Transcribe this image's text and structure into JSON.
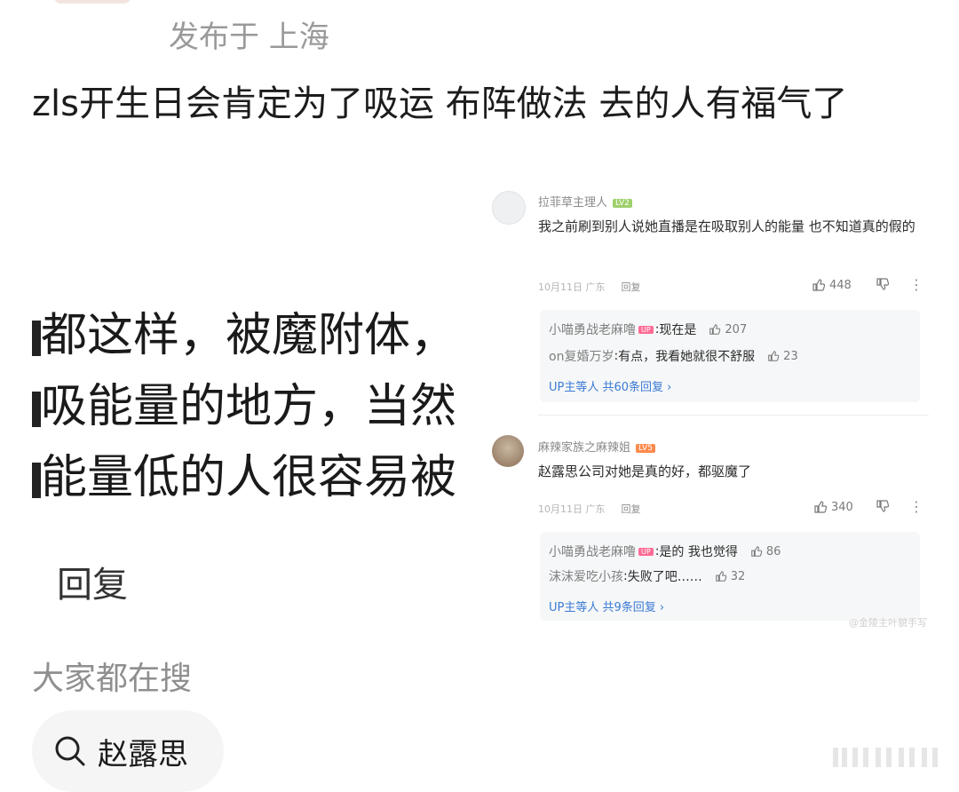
{
  "header": {
    "location": "发布于 上海"
  },
  "post": {
    "text": "zls开生日会肯定为了吸运 布阵做法 去的人有福气了"
  },
  "crop_image": {
    "lines": [
      "都这样，被魔附体，",
      "吸能量的地方，当然",
      "能量低的人很容易被"
    ]
  },
  "actions": {
    "reply_label": "回复"
  },
  "trending": {
    "heading": "大家都在搜",
    "chip_label": "赵露思"
  },
  "screenshot": {
    "comments": [
      {
        "user": "拉菲草主理人",
        "level": "LV2",
        "text": "我之前刷到别人说她直播是在吸取别人的能量 也不知道真的假的",
        "date": "10月11日 广东",
        "reply": "回复",
        "likes": "448",
        "subreplies": [
          {
            "name": "小喵勇战老麻噜",
            "badge": "UP",
            "text": "现在是",
            "likes": "207"
          },
          {
            "name": "on复婚万岁",
            "badge": "",
            "text": "有点，我看她就很不舒服",
            "likes": "23"
          }
        ],
        "more_link": "UP主等人 共60条回复 ›"
      },
      {
        "user": "麻辣家族之麻辣姐",
        "level": "LV5",
        "text": "赵露思公司对她是真的好，都驱魔了",
        "date": "10月11日 广东",
        "reply": "回复",
        "likes": "340",
        "subreplies": [
          {
            "name": "小喵勇战老麻噜",
            "badge": "UP",
            "text": "是的 我也觉得",
            "likes": "86"
          },
          {
            "name": "沫沫爱吃小孩",
            "badge": "",
            "text": "失败了吧……",
            "likes": "32"
          }
        ],
        "more_link": "UP主等人 共9条回复 ›"
      }
    ],
    "watermark": "@金陵主叶貌手写"
  }
}
